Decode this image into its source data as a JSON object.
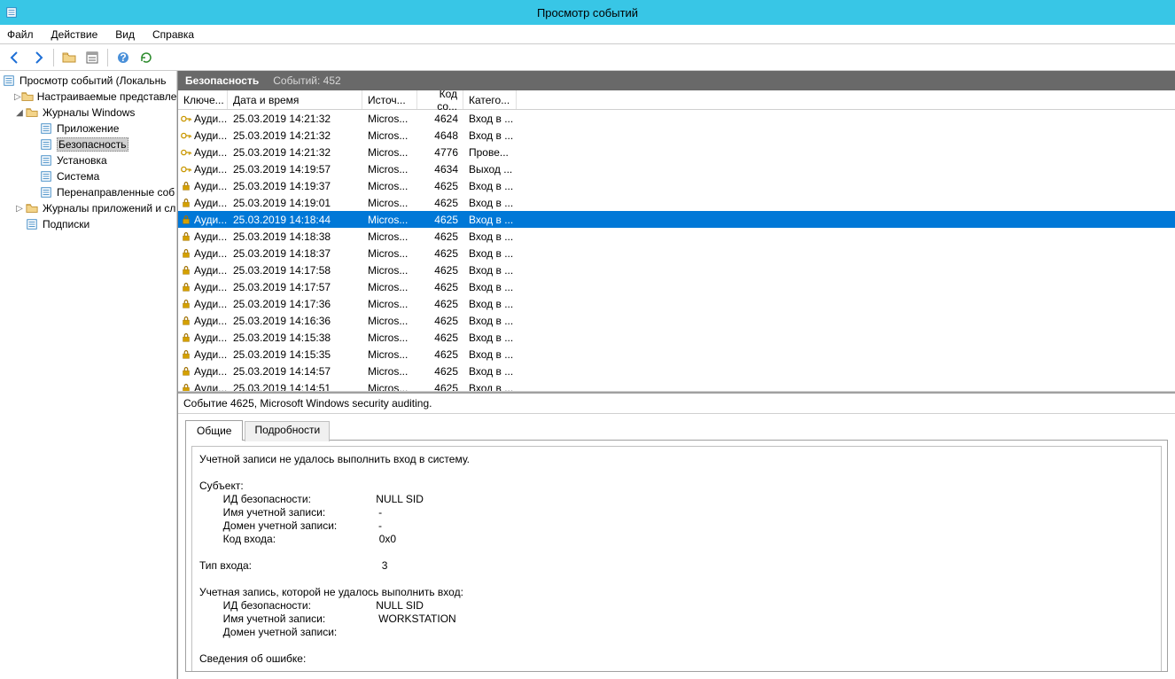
{
  "window": {
    "title": "Просмотр событий"
  },
  "menu": {
    "file": "Файл",
    "action": "Действие",
    "view": "Вид",
    "help": "Справка"
  },
  "tree": {
    "root": "Просмотр событий (Локальнь",
    "custom_views": "Настраиваемые представле",
    "windows_logs": "Журналы Windows",
    "app": "Приложение",
    "security": "Безопасность",
    "setup": "Установка",
    "system": "Система",
    "forwarded": "Перенаправленные соб",
    "app_services": "Журналы приложений и сл",
    "subscriptions": "Подписки"
  },
  "content_header": {
    "section": "Безопасность",
    "count_label": "Событий: 452"
  },
  "columns": {
    "keywords": "Ключе...",
    "datetime": "Дата и время",
    "source": "Источ...",
    "code": "Код со...",
    "category": "Катего..."
  },
  "events": [
    {
      "kw": "Ауди...",
      "dt": "25.03.2019 14:21:32",
      "src": "Micros...",
      "code": "4624",
      "cat": "Вход в ...",
      "icon": "key"
    },
    {
      "kw": "Ауди...",
      "dt": "25.03.2019 14:21:32",
      "src": "Micros...",
      "code": "4648",
      "cat": "Вход в ...",
      "icon": "key"
    },
    {
      "kw": "Ауди...",
      "dt": "25.03.2019 14:21:32",
      "src": "Micros...",
      "code": "4776",
      "cat": "Прове...",
      "icon": "key"
    },
    {
      "kw": "Ауди...",
      "dt": "25.03.2019 14:19:57",
      "src": "Micros...",
      "code": "4634",
      "cat": "Выход ...",
      "icon": "key"
    },
    {
      "kw": "Ауди...",
      "dt": "25.03.2019 14:19:37",
      "src": "Micros...",
      "code": "4625",
      "cat": "Вход в ...",
      "icon": "lock"
    },
    {
      "kw": "Ауди...",
      "dt": "25.03.2019 14:19:01",
      "src": "Micros...",
      "code": "4625",
      "cat": "Вход в ...",
      "icon": "lock"
    },
    {
      "kw": "Ауди...",
      "dt": "25.03.2019 14:18:44",
      "src": "Micros...",
      "code": "4625",
      "cat": "Вход в ...",
      "icon": "lock",
      "selected": true
    },
    {
      "kw": "Ауди...",
      "dt": "25.03.2019 14:18:38",
      "src": "Micros...",
      "code": "4625",
      "cat": "Вход в ...",
      "icon": "lock"
    },
    {
      "kw": "Ауди...",
      "dt": "25.03.2019 14:18:37",
      "src": "Micros...",
      "code": "4625",
      "cat": "Вход в ...",
      "icon": "lock"
    },
    {
      "kw": "Ауди...",
      "dt": "25.03.2019 14:17:58",
      "src": "Micros...",
      "code": "4625",
      "cat": "Вход в ...",
      "icon": "lock"
    },
    {
      "kw": "Ауди...",
      "dt": "25.03.2019 14:17:57",
      "src": "Micros...",
      "code": "4625",
      "cat": "Вход в ...",
      "icon": "lock"
    },
    {
      "kw": "Ауди...",
      "dt": "25.03.2019 14:17:36",
      "src": "Micros...",
      "code": "4625",
      "cat": "Вход в ...",
      "icon": "lock"
    },
    {
      "kw": "Ауди...",
      "dt": "25.03.2019 14:16:36",
      "src": "Micros...",
      "code": "4625",
      "cat": "Вход в ...",
      "icon": "lock"
    },
    {
      "kw": "Ауди...",
      "dt": "25.03.2019 14:15:38",
      "src": "Micros...",
      "code": "4625",
      "cat": "Вход в ...",
      "icon": "lock"
    },
    {
      "kw": "Ауди...",
      "dt": "25.03.2019 14:15:35",
      "src": "Micros...",
      "code": "4625",
      "cat": "Вход в ...",
      "icon": "lock"
    },
    {
      "kw": "Ауди...",
      "dt": "25.03.2019 14:14:57",
      "src": "Micros...",
      "code": "4625",
      "cat": "Вход в ...",
      "icon": "lock"
    },
    {
      "kw": "Ауди...",
      "dt": "25.03.2019 14:14:51",
      "src": "Micros...",
      "code": "4625",
      "cat": "Вход в ...",
      "icon": "lock"
    }
  ],
  "detail": {
    "title": "Событие 4625, Microsoft Windows security auditing.",
    "tab_general": "Общие",
    "tab_details": "Подробности",
    "lines": [
      "Учетной записи не удалось выполнить вход в систему.",
      "",
      "Субъект:",
      "        ИД безопасности:                      NULL SID",
      "        Имя учетной записи:                  -",
      "        Домен учетной записи:              -",
      "        Код входа:                                   0x0",
      "",
      "Тип входа:                                            3",
      "",
      "Учетная запись, которой не удалось выполнить вход:",
      "        ИД безопасности:                      NULL SID",
      "        Имя учетной записи:                  WORKSTATION",
      "        Домен учетной записи:",
      "",
      "Сведения об ошибке:"
    ]
  }
}
